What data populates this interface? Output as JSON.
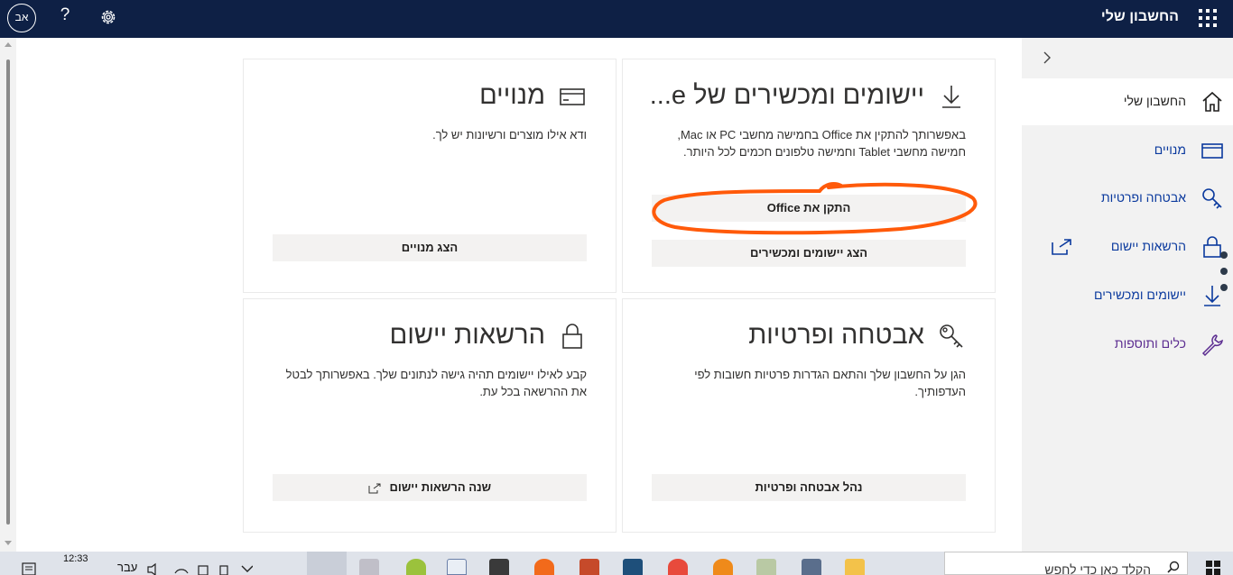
{
  "header": {
    "title": "החשבון שלי",
    "avatar_initials": "אב",
    "help_symbol": "?",
    "waffle_icon": "app-launcher-icon",
    "settings_icon": "gear-icon"
  },
  "cards": {
    "apps": {
      "title": "יישומים ומכשירים של e...",
      "description": "באפשרותך להתקין את Office בחמישה מחשבי PC או Mac, חמישה מחשבי Tablet וחמישה טלפונים חכמים לכל היותר.",
      "install_button": "התקן את Office",
      "view_button": "הצג יישומים ומכשירים",
      "icon": "download-icon"
    },
    "subscriptions": {
      "title": "מנויים",
      "description": "ודא אילו מוצרים ורשיונות יש לך.",
      "view_button": "הצג מנויים",
      "icon": "credit-card-icon"
    },
    "security": {
      "title": "אבטחה ופרטיות",
      "description": "הגן על החשבון שלך והתאם הגדרות פרטיות חשובות לפי העדפותיך.",
      "manage_button": "נהל אבטחה ופרטיות",
      "icon": "key-icon"
    },
    "permissions": {
      "title": "הרשאות יישום",
      "description": "קבע לאילו יישומים תהיה גישה לנתונים שלך. באפשרותך לבטל את ההרשאה בכל עת.",
      "change_button": "שנה הרשאות יישום",
      "icon": "lock-icon"
    }
  },
  "sidebar": {
    "collapse_icon": "chevron-right-icon",
    "items": [
      {
        "label": "החשבון שלי",
        "icon": "home-icon",
        "active": true
      },
      {
        "label": "מנויים",
        "icon": "credit-card-icon"
      },
      {
        "label": "אבטחה ופרטיות",
        "icon": "key-icon"
      },
      {
        "label": "הרשאות יישום",
        "icon": "lock-icon"
      },
      {
        "label": "יישומים ומכשירים",
        "icon": "download-icon"
      },
      {
        "label": "כלים ותוספות",
        "icon": "wrench-icon"
      }
    ]
  },
  "annotation": {
    "color": "#ff5a0a",
    "description": "orange hand-drawn circle around install button"
  },
  "taskbar": {
    "search_placeholder": "הקלד כאן כדי לחפש",
    "time": "12:33",
    "language": "עבר"
  },
  "colors": {
    "topbar": "#0e2045",
    "link": "#0b3a9e",
    "tools": "#5c2d91",
    "annotation": "#ff5a0a"
  }
}
